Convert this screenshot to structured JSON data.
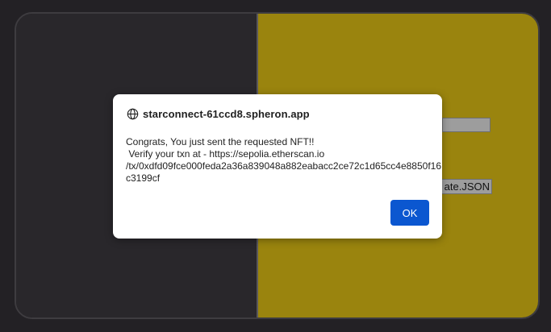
{
  "background": {
    "file_button_label": "ate.JSON",
    "colors": {
      "left_panel": "#29272b",
      "right_panel": "#9a840e"
    }
  },
  "dialog": {
    "origin_icon": "globe-icon",
    "origin": "starconnect-61ccd8.spheron.app",
    "message_lines": [
      "Congrats, You just sent the requested NFT!!",
      " Verify your txn at - https://sepolia.etherscan.io",
      "/tx/0xdfd09fce000feda2a36a839048a882eabacc2ce72c1d65cc4e8850f16",
      "c3199cf"
    ],
    "ok_label": "OK",
    "ok_color": "#0b57d0"
  }
}
